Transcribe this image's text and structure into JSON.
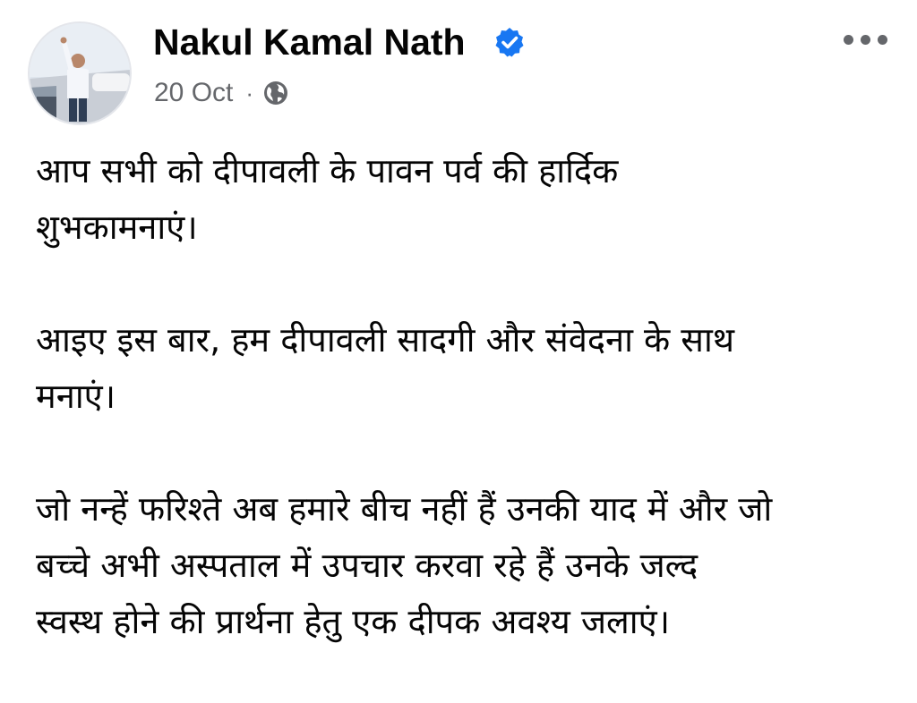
{
  "post": {
    "author": {
      "name": "Nakul Kamal Nath",
      "verified_icon": "verified-badge-icon",
      "avatar_icon": "profile-photo"
    },
    "date": "20 Oct",
    "separator": "·",
    "audience_icon": "globe-icon",
    "more_icon": "more-options-icon",
    "colors": {
      "verified": "#1877f2",
      "secondary_text": "#65676b",
      "primary_text": "#050505"
    },
    "paragraphs": [
      "आप सभी को दीपावली के पावन पर्व की हार्दिक\nशुभकामनाएं।",
      "आइए इस बार, हम दीपावली सादगी और संवेदना के साथ\nमनाएं।",
      "जो नन्हें फरिश्ते अब हमारे बीच नहीं हैं उनकी याद में और जो\nबच्चे अभी अस्पताल में उपचार करवा रहे हैं उनके जल्द\nस्वस्थ होने की प्रार्थना हेतु एक दीपक अवश्य जलाएं।"
    ]
  }
}
